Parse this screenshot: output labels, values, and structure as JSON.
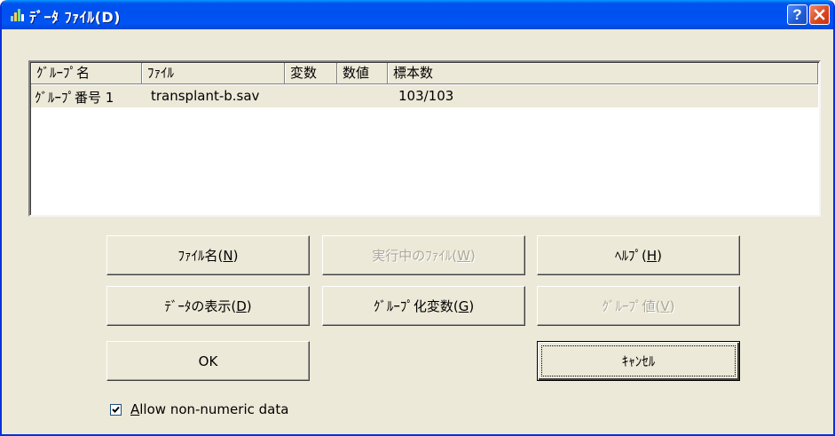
{
  "window": {
    "title": "ﾃﾞｰﾀ ﾌｧｲﾙ(D)",
    "help_label": "?",
    "title_color": "#0054e3"
  },
  "list": {
    "columns": [
      "ｸﾞﾙｰﾌﾟ名",
      "ﾌｧｲﾙ",
      "変数",
      "数値",
      "標本数"
    ],
    "rows": [
      {
        "group": "ｸﾞﾙｰﾌﾟ番号 1",
        "file": "transplant-b.sav",
        "vars": "",
        "numeric": "",
        "samples": "103/103"
      }
    ]
  },
  "buttons": {
    "filename": {
      "text": "ﾌｧｲﾙ名(",
      "key": "N",
      "end": ")"
    },
    "running_file": {
      "text": "実行中のﾌｧｲﾙ(",
      "key": "W",
      "end": ")"
    },
    "help": {
      "text": "ﾍﾙﾌﾟ(",
      "key": "H",
      "end": ")"
    },
    "show_data": {
      "text": "ﾃﾞｰﾀの表示(",
      "key": "D",
      "end": ")"
    },
    "group_var": {
      "text": "ｸﾞﾙｰﾌﾟ化変数(",
      "key": "G",
      "end": ")"
    },
    "group_value": {
      "text": "ｸﾞﾙｰﾌﾟ値(",
      "key": "V",
      "end": ")"
    },
    "ok": "OK",
    "cancel": "ｷｬﾝｾﾙ"
  },
  "checkbox": {
    "key": "A",
    "rest": "llow non-numeric data",
    "checked": true
  }
}
